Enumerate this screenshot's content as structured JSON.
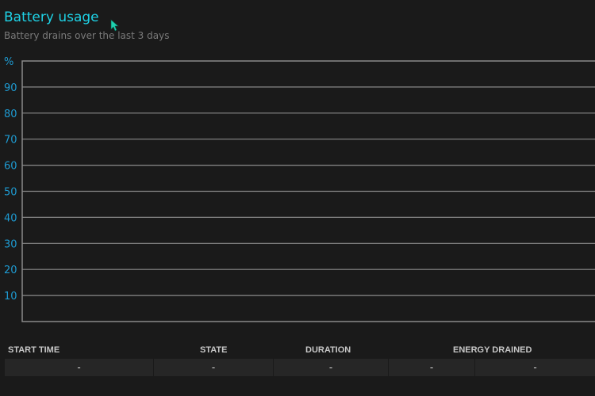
{
  "header": {
    "title": "Battery usage",
    "subtitle": "Battery drains over the last 3 days"
  },
  "colors": {
    "accent": "#1ed2e6",
    "axis_label": "#1e9bd2",
    "gridline": "#8a8a8a",
    "background": "#1a1a1a"
  },
  "chart_data": {
    "type": "line",
    "ylabel": "%",
    "ylim": [
      0,
      100
    ],
    "yticks": [
      "90",
      "80",
      "70",
      "60",
      "50",
      "40",
      "30",
      "20",
      "10"
    ],
    "grid": true,
    "series": []
  },
  "table": {
    "columns": [
      "START TIME",
      "STATE",
      "DURATION",
      "ENERGY DRAINED"
    ],
    "rows": [
      [
        "-",
        "-",
        "-",
        "-",
        "-"
      ]
    ]
  },
  "cursor": "pointer-arrow-icon"
}
